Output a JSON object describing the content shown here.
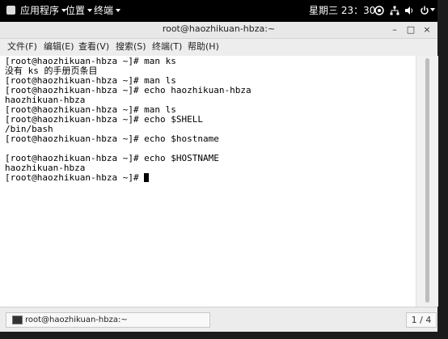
{
  "topbar": {
    "applications_label": "应用程序",
    "places_label": "位置",
    "terminal_label": "终端",
    "day": "星期三",
    "time": "23：30"
  },
  "window": {
    "title": "root@haozhikuan-hbza:~",
    "minimize": "–",
    "maximize": "□",
    "close": "×"
  },
  "menubar": {
    "items": [
      "文件(F)",
      "编辑(E)",
      "查看(V)",
      "搜索(S)",
      "终端(T)",
      "帮助(H)"
    ]
  },
  "terminal": {
    "lines": [
      "[root@haozhikuan-hbza ~]# man ks",
      "没有 ks 的手册页条目",
      "[root@haozhikuan-hbza ~]# man ls",
      "[root@haozhikuan-hbza ~]# echo haozhikuan-hbza",
      "haozhikuan-hbza",
      "[root@haozhikuan-hbza ~]# man ls",
      "[root@haozhikuan-hbza ~]# echo $SHELL",
      "/bin/bash",
      "[root@haozhikuan-hbza ~]# echo $hostname",
      "",
      "[root@haozhikuan-hbza ~]# echo $HOSTNAME",
      "haozhikuan-hbza",
      "[root@haozhikuan-hbza ~]# "
    ]
  },
  "taskbar": {
    "task_label": "root@haozhikuan-hbza:~",
    "workspace": "1 / 4"
  },
  "icons": [
    "apps-menu-icon",
    "accessibility-icon",
    "network-icon",
    "volume-icon",
    "power-icon",
    "terminal-window-icon"
  ]
}
